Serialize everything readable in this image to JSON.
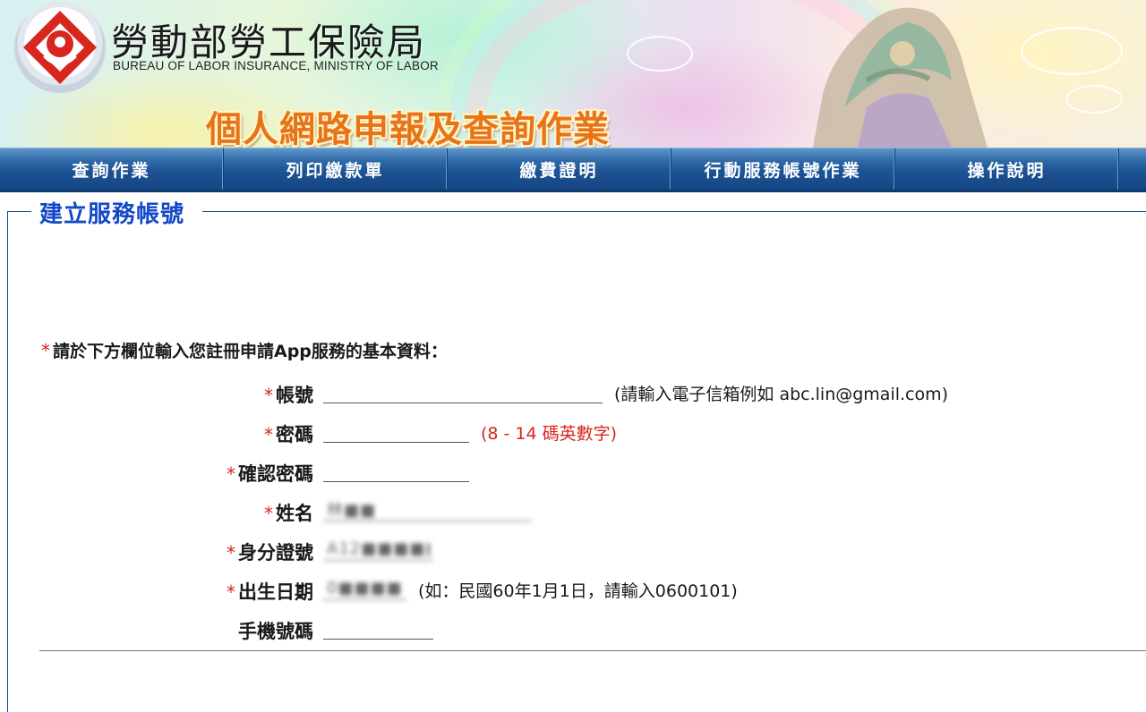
{
  "header": {
    "org_name_cn": "勞動部勞工保險局",
    "org_name_en": "BUREAU OF LABOR INSURANCE, MINISTRY OF LABOR",
    "subtitle": "個人網路申報及查詢作業",
    "logo_icon": "bli-logo-icon",
    "accent_color": "#e8741a"
  },
  "nav": {
    "items": [
      {
        "label": "查詢作業"
      },
      {
        "label": "列印繳款單"
      },
      {
        "label": "繳費證明"
      },
      {
        "label": "行動服務帳號作業"
      },
      {
        "label": "操作說明"
      }
    ]
  },
  "form": {
    "legend": "建立服務帳號",
    "intro": "請於下方欄位輸入您註冊申請App服務的基本資料：",
    "required_mark": "*",
    "colon": "：",
    "fields": [
      {
        "label": "帳號",
        "required": true,
        "value": "",
        "hint": "(請輸入電子信箱例如 abc.lin@gmail.com)"
      },
      {
        "label": "密碼",
        "required": true,
        "value": "",
        "hint": "(8 - 14 碼英數字)"
      },
      {
        "label": "確認密碼",
        "required": true,
        "value": "",
        "hint": ""
      },
      {
        "label": "姓名",
        "required": true,
        "value": "林■■",
        "hint": ""
      },
      {
        "label": "身分證號",
        "required": true,
        "value": "A12■■■■■■■",
        "hint": ""
      },
      {
        "label": "出生日期",
        "required": true,
        "value": "0■■■■■",
        "hint": "(如：民國60年1月1日，請輸入0600101)"
      },
      {
        "label": "手機號碼",
        "required": false,
        "value": "",
        "hint": ""
      }
    ]
  },
  "colors": {
    "nav_bg": "#1d5394",
    "legend": "#1248c8",
    "required": "#d8261e"
  }
}
